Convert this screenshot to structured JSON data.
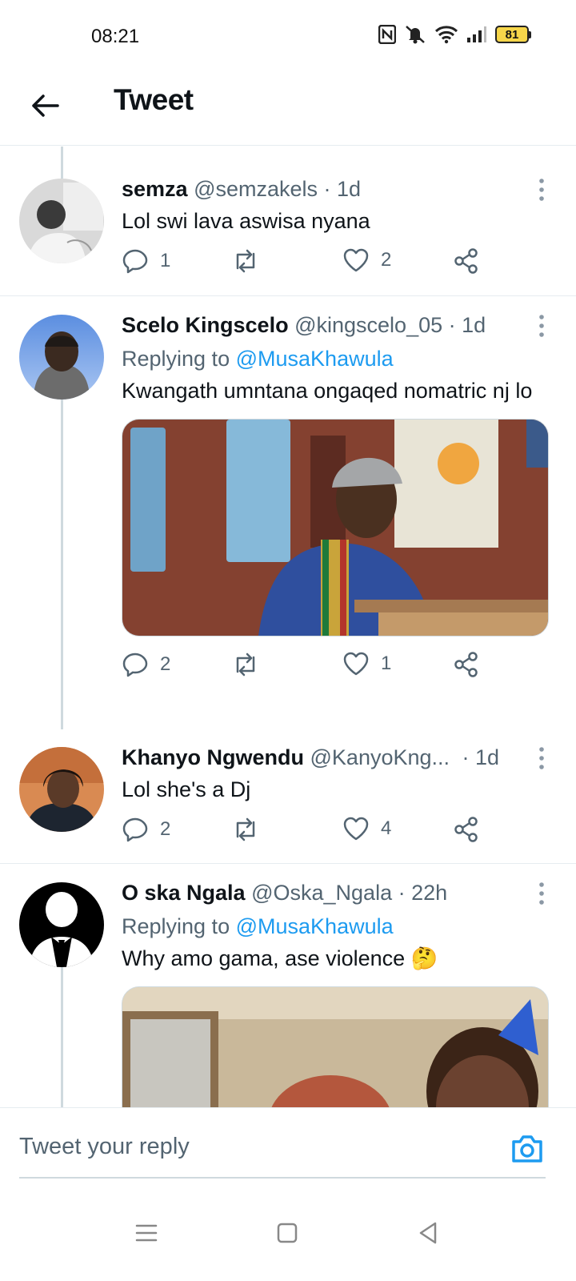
{
  "status_bar": {
    "time": "08:21",
    "battery_level": "81",
    "icons": [
      "nfc-icon",
      "mute-icon",
      "wifi-icon",
      "signal-icon",
      "battery-icon"
    ]
  },
  "header": {
    "title": "Tweet",
    "back_icon": "arrow-left-icon"
  },
  "tweets": [
    {
      "name": "semza",
      "handle": "@semzakels",
      "time": "· 1d",
      "text": "Lol swi lava aswisa nyana",
      "replies": "1",
      "retweets": "",
      "likes": "2"
    },
    {
      "name": "Scelo Kingscelo",
      "handle": "@kingscelo_05",
      "time": "· 1d",
      "replying_prefix": "Replying to",
      "replying_to": "@MusaKhawula",
      "text": "Kwangath umntana ongaqed nomatric nj lo",
      "replies": "2",
      "retweets": "",
      "likes": "1"
    },
    {
      "name": "Khanyo Ngwendu",
      "handle": "@KanyoKng...",
      "time": "· 1d",
      "text": "Lol she's a Dj",
      "replies": "2",
      "retweets": "",
      "likes": "4"
    },
    {
      "name": "O ska Ngala",
      "handle": "@Oska_Ngala",
      "time": "· 22h",
      "replying_prefix": "Replying to",
      "replying_to": "@MusaKhawula",
      "text": "Why amo gama, ase violence 🤔"
    }
  ],
  "reply_bar": {
    "placeholder": "Tweet your reply",
    "camera_icon": "camera-icon"
  },
  "colors": {
    "accent": "#1d9bf0",
    "text_secondary": "#536471",
    "divider": "#e6ecf0",
    "battery": "#f6d64a"
  }
}
